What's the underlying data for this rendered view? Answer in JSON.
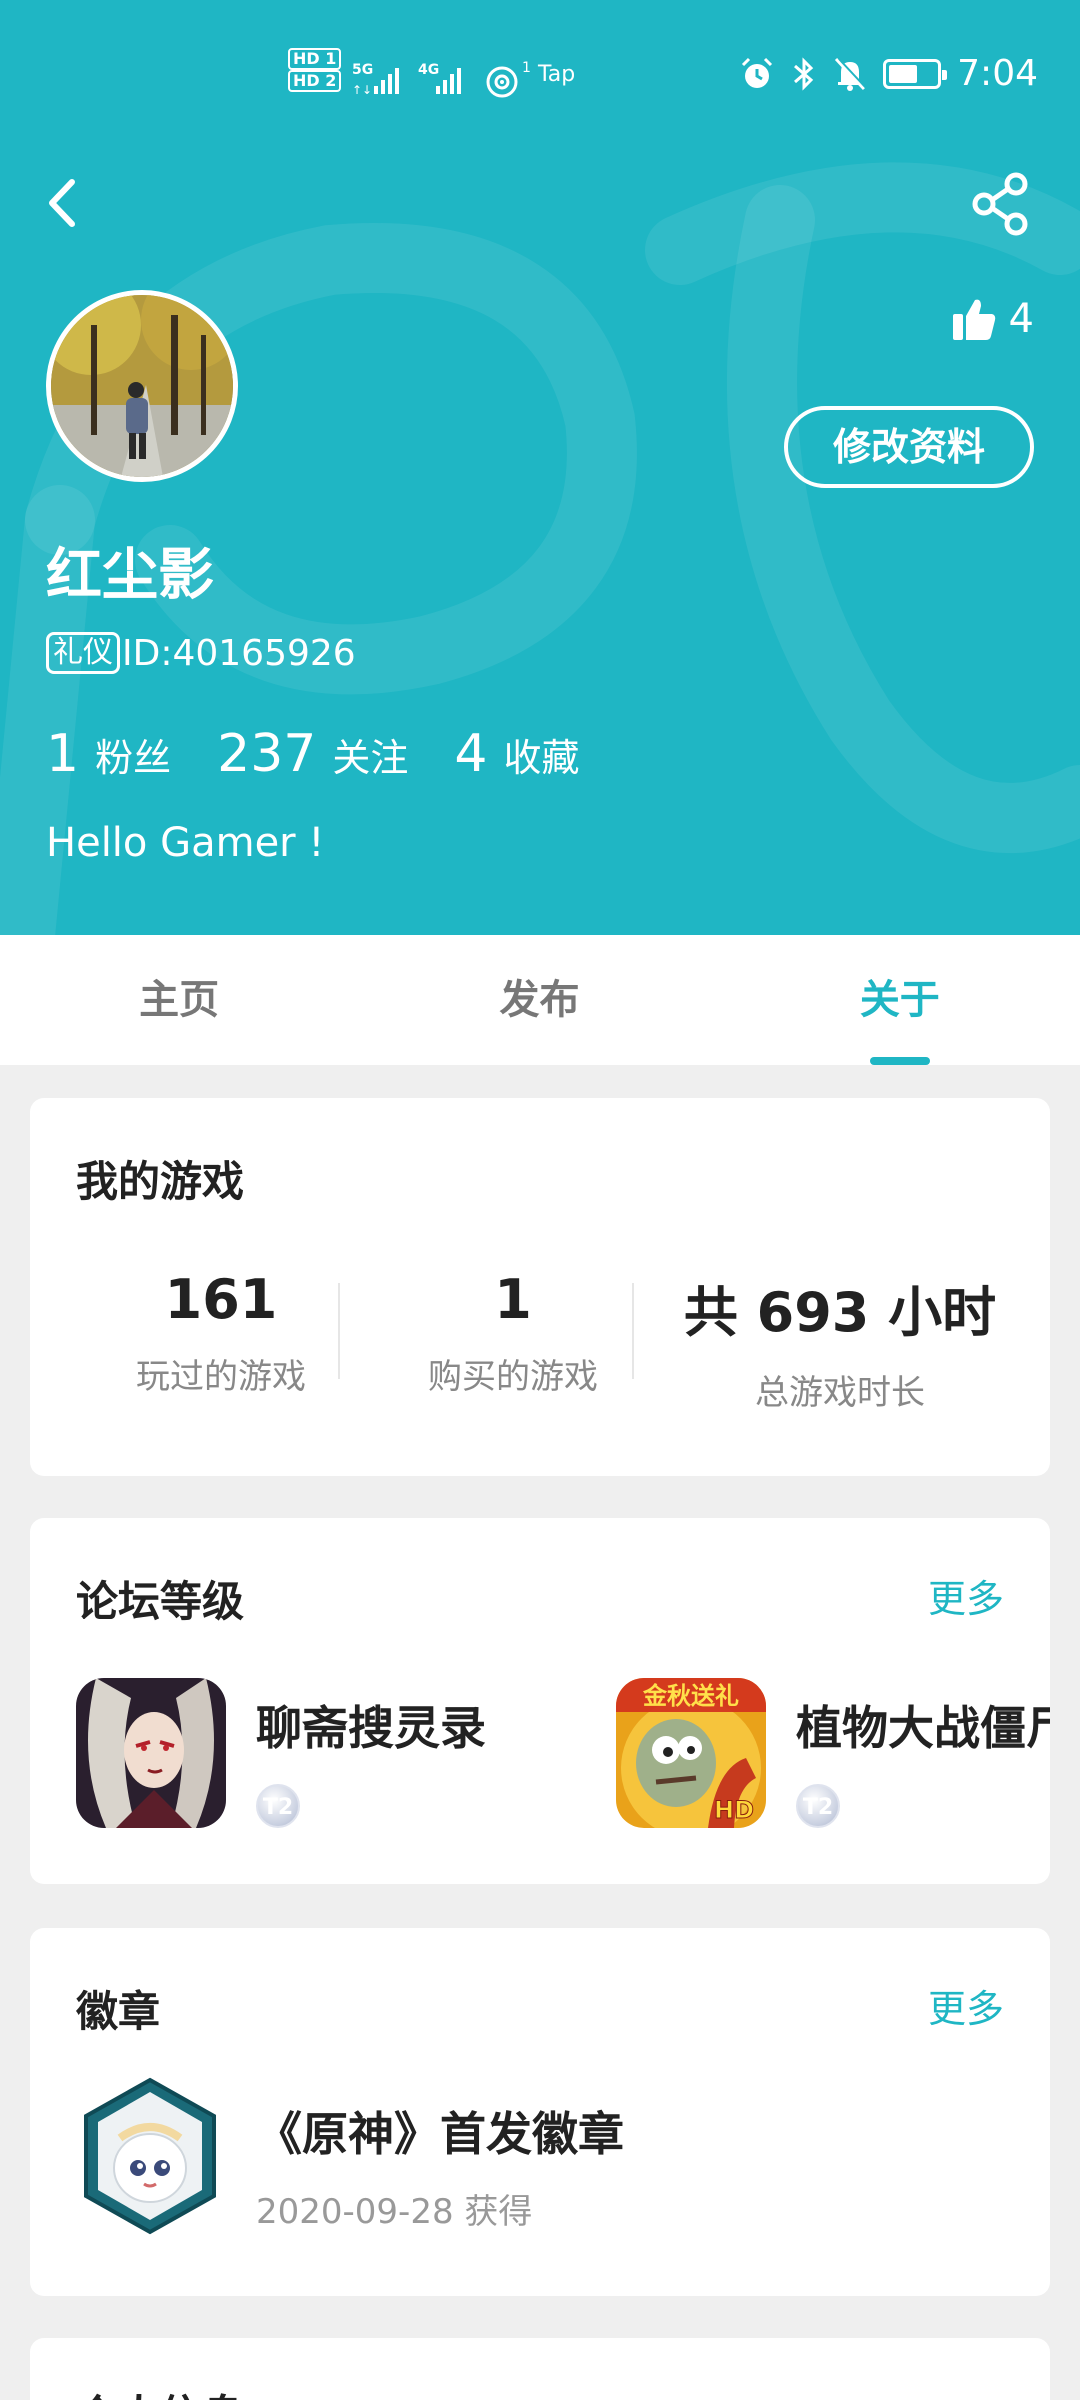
{
  "status_bar": {
    "hd1": "HD 1",
    "hd2": "HD 2",
    "signal1": "5G",
    "signal2": "4G",
    "hotspot": "1",
    "tap": "Tap",
    "time": "7:04",
    "battery_level": 0.6
  },
  "header": {
    "like_count": "4",
    "edit_profile_label": "修改资料",
    "username": "红尘影",
    "id_badge": "礼仪",
    "id_text": "ID:40165926",
    "stats": [
      {
        "num": "1",
        "label": "粉丝"
      },
      {
        "num": "237",
        "label": "关注"
      },
      {
        "num": "4",
        "label": "收藏"
      }
    ],
    "bio": "Hello Gamer !"
  },
  "tabs": [
    {
      "label": "主页",
      "active": false
    },
    {
      "label": "发布",
      "active": false
    },
    {
      "label": "关于",
      "active": true
    }
  ],
  "my_games": {
    "title": "我的游戏",
    "stats": [
      {
        "value": "161",
        "label": "玩过的游戏"
      },
      {
        "value": "1",
        "label": "购买的游戏"
      },
      {
        "value": "共 693 小时",
        "label": "总游戏时长"
      }
    ]
  },
  "forum_level": {
    "title": "论坛等级",
    "more": "更多",
    "items": [
      {
        "name": "聊斋搜灵录",
        "level": "T2"
      },
      {
        "name": "植物大战僵尸",
        "level": "T2",
        "icon_text": "金秋送礼",
        "icon_badge": "HD"
      }
    ]
  },
  "badges": {
    "title": "徽章",
    "more": "更多",
    "item": {
      "name": "《原神》首发徽章",
      "date": "2020-09-28 获得"
    }
  },
  "personal_info": {
    "title": "个人信息"
  },
  "colors": {
    "accent": "#1fb6c4",
    "background": "#efefef"
  }
}
